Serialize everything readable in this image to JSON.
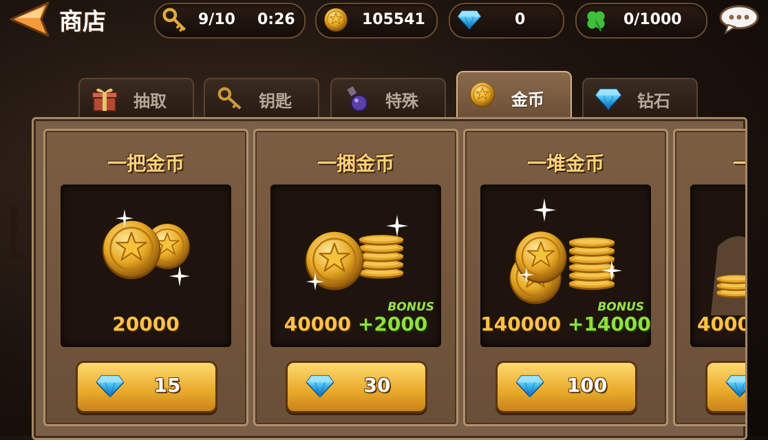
{
  "header": {
    "title": "商店",
    "keys": {
      "count": "9/10",
      "timer": "0:26"
    },
    "gold": "105541",
    "diamonds": "0",
    "clover": "0/1000"
  },
  "tabs": [
    {
      "label": "抽取",
      "icon": "gift-box-icon",
      "active": false
    },
    {
      "label": "钥匙",
      "icon": "key-icon",
      "active": false
    },
    {
      "label": "特殊",
      "icon": "potion-icon",
      "active": false
    },
    {
      "label": "金币",
      "icon": "gold-coin-icon",
      "active": true
    },
    {
      "label": "钻石",
      "icon": "diamond-icon",
      "active": false
    }
  ],
  "offers": [
    {
      "title": "一把金币",
      "amount": "20000",
      "bonus_label": "",
      "bonus": "",
      "price": "15"
    },
    {
      "title": "一捆金币",
      "amount": "40000",
      "bonus_label": "BONUS",
      "bonus": "+2000",
      "price": "30"
    },
    {
      "title": "一堆金币",
      "amount": "140000",
      "bonus_label": "BONUS",
      "bonus": "+14000",
      "price": "100"
    },
    {
      "title": "一",
      "amount": "4000",
      "bonus_label": "",
      "bonus": "",
      "price": ""
    }
  ],
  "colors": {
    "gold_text": "#ffc24a",
    "bonus_green": "#8fe03e",
    "title_gold": "#ffd57a",
    "panel_brown": "#7a6048",
    "button_gold": "#e8a92b"
  }
}
